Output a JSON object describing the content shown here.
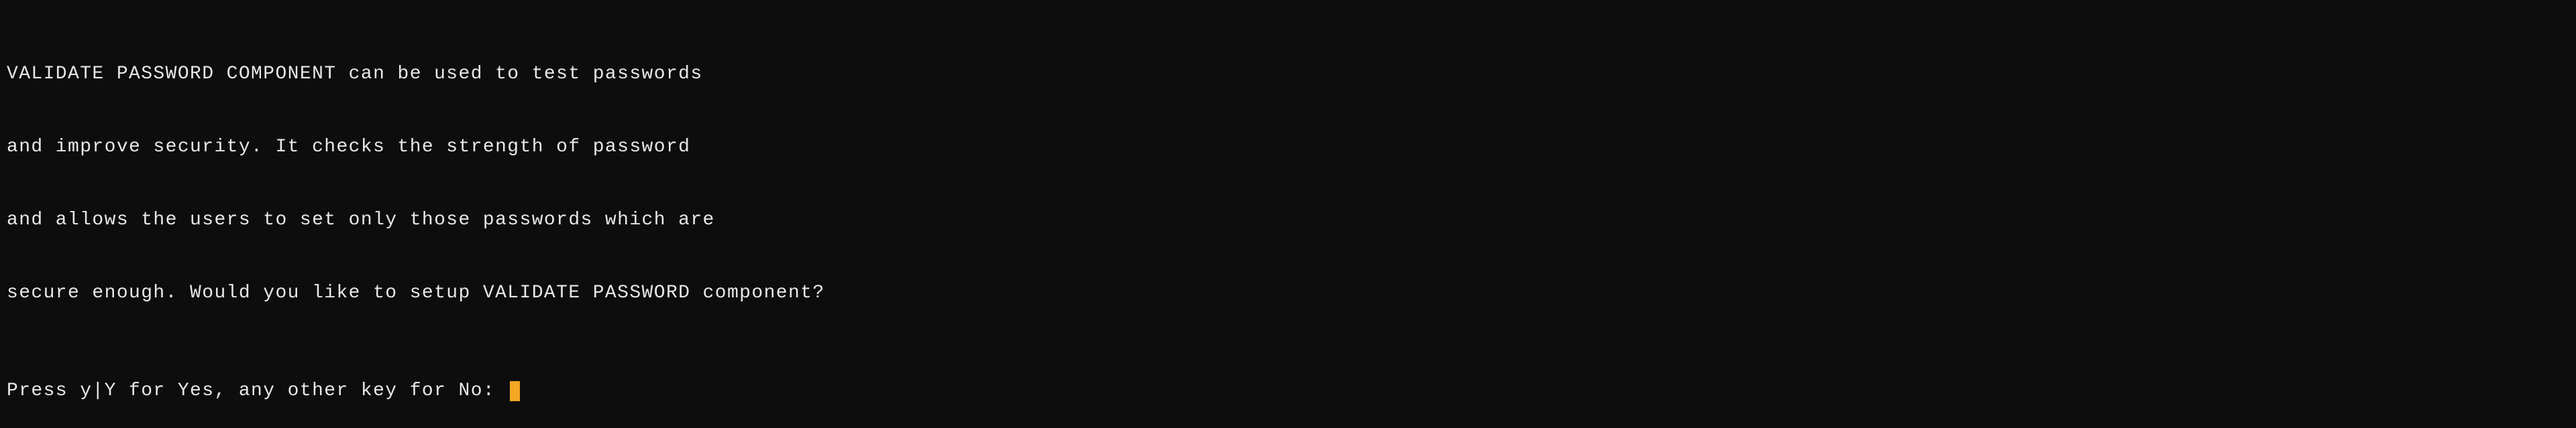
{
  "terminal": {
    "lines": [
      "VALIDATE PASSWORD COMPONENT can be used to test passwords",
      "and improve security. It checks the strength of password",
      "and allows the users to set only those passwords which are",
      "secure enough. Would you like to setup VALIDATE PASSWORD component?"
    ],
    "prompt": "Press y|Y for Yes, any other key for No: "
  }
}
